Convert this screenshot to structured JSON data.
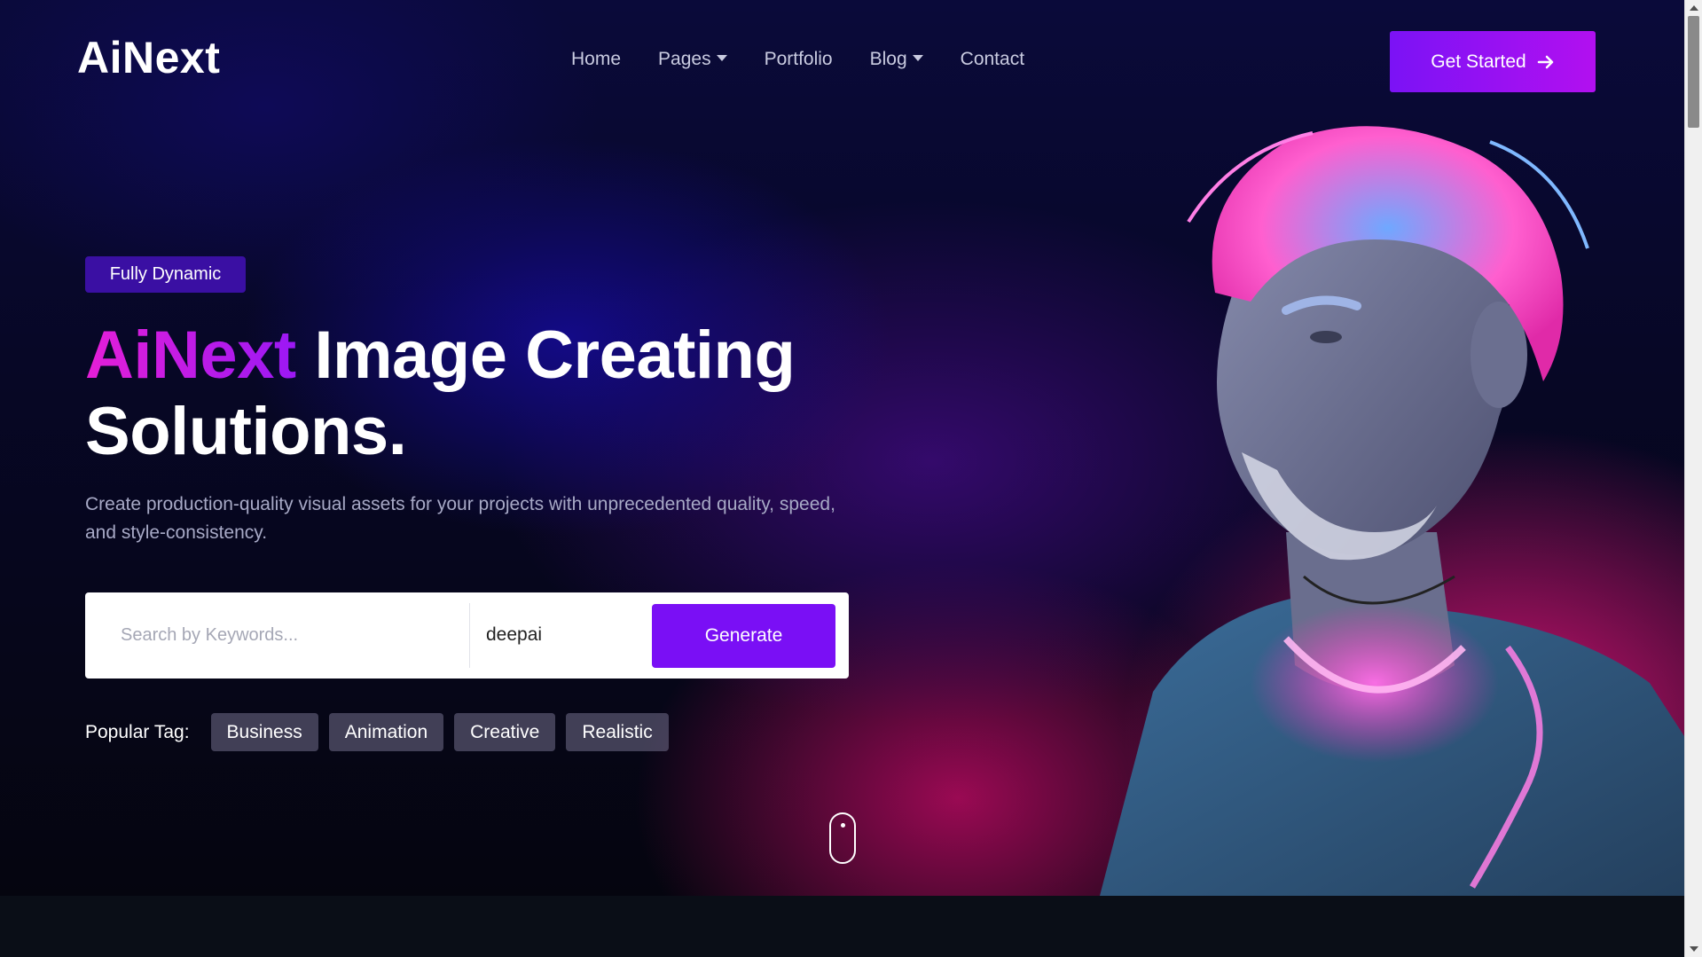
{
  "header": {
    "logo": "AiNext",
    "nav": [
      {
        "label": "Home"
      },
      {
        "label": "Pages"
      },
      {
        "label": "Portfolio"
      },
      {
        "label": "Blog"
      },
      {
        "label": "Contact"
      }
    ],
    "cta_label": "Get Started"
  },
  "hero": {
    "badge": "Fully Dynamic",
    "title_brand": "AiNext",
    "title_rest": " Image Creating Solutions.",
    "subtitle": "Create production-quality visual assets for your projects with unprecedented quality, speed, and style-consistency.",
    "search": {
      "placeholder": "Search by Keywords...",
      "model_value": "deepai",
      "button_label": "Generate"
    },
    "tags_label": "Popular Tag:",
    "tags": [
      "Business",
      "Animation",
      "Creative",
      "Realistic"
    ]
  },
  "colors": {
    "accent": "#7a0ff5",
    "brand_gradient_start": "#e51fd7",
    "brand_gradient_end": "#9b18f5",
    "badge_bg": "#3a0fa3"
  },
  "icons": {
    "cta_icon": "arrow-right-icon",
    "nav_dropdown_icon": "caret-down-icon",
    "scroll_indicator": "mouse-scroll-icon"
  }
}
